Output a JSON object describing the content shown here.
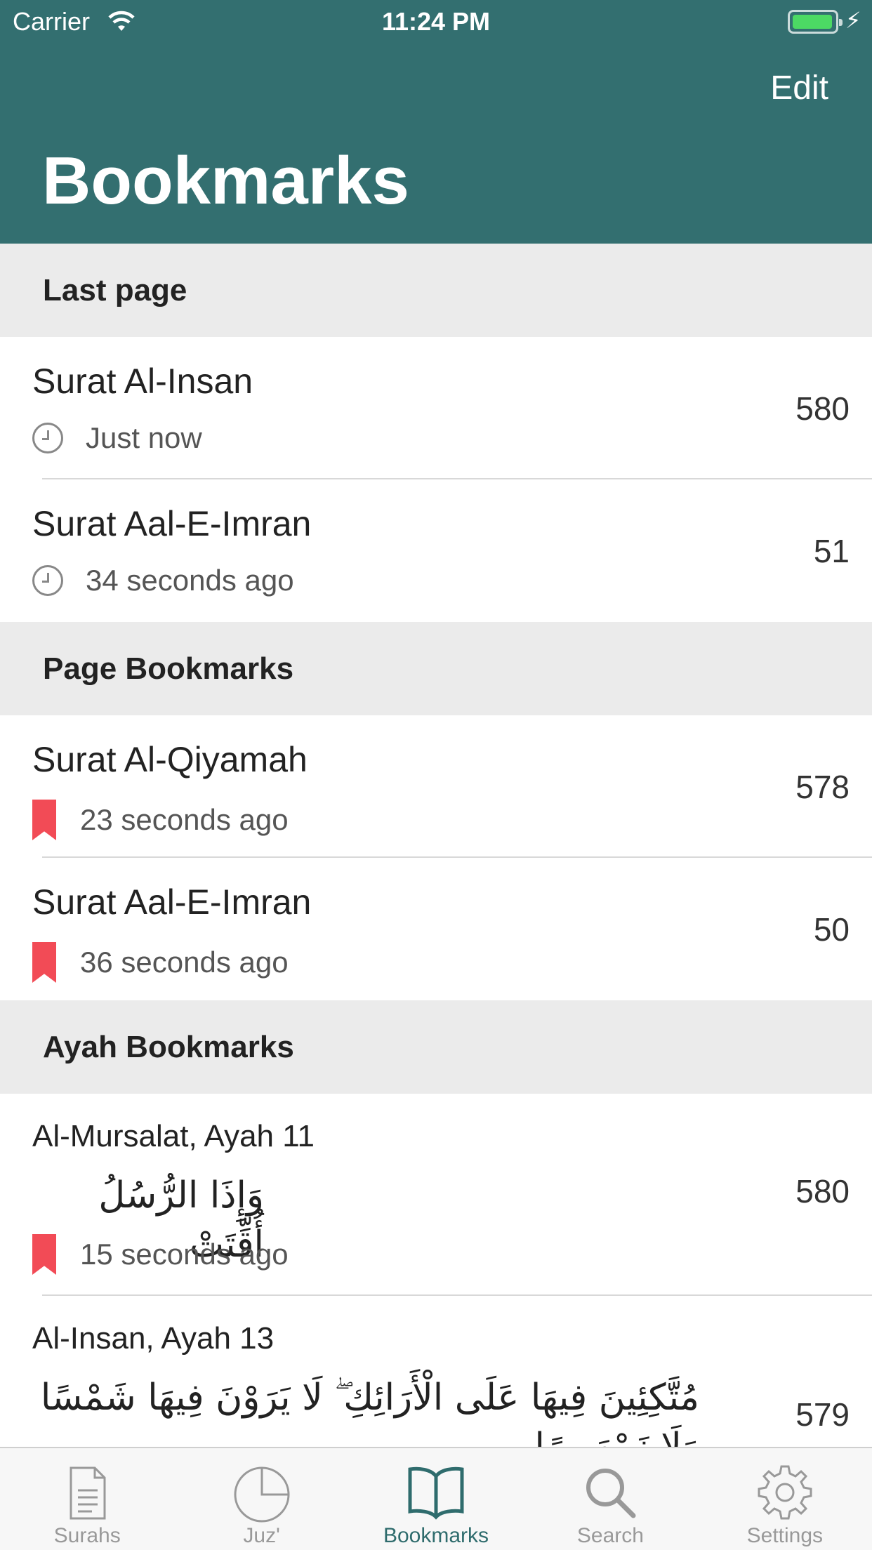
{
  "status_bar": {
    "carrier": "Carrier",
    "time": "11:24 PM"
  },
  "header": {
    "edit_label": "Edit",
    "title": "Bookmarks"
  },
  "sections": {
    "last_page": {
      "title": "Last page",
      "items": [
        {
          "title": "Surat Al-Insan",
          "time": "Just now",
          "page": "580",
          "icon": "clock-icon"
        },
        {
          "title": "Surat Aal-E-Imran",
          "time": "34 seconds ago",
          "page": "51",
          "icon": "clock-icon"
        }
      ]
    },
    "page_bookmarks": {
      "title": "Page Bookmarks",
      "items": [
        {
          "title": "Surat Al-Qiyamah",
          "time": "23 seconds ago",
          "page": "578",
          "icon": "bookmark-icon"
        },
        {
          "title": "Surat Aal-E-Imran",
          "time": "36 seconds ago",
          "page": "50",
          "icon": "bookmark-icon"
        }
      ]
    },
    "ayah_bookmarks": {
      "title": "Ayah Bookmarks",
      "items": [
        {
          "title": "Al-Mursalat, Ayah 11",
          "text": "وَإِذَا الرُّسُلُ أُقِّتَتْ",
          "time": "15 seconds ago",
          "page": "580",
          "icon": "bookmark-icon"
        },
        {
          "title": "Al-Insan, Ayah 13",
          "text": "مُتَّكِئِينَ فِيهَا عَلَى الْأَرَائِكِ ۖ لَا يَرَوْنَ فِيهَا شَمْسًا وَلَا زَمْهَرِيرًا",
          "page": "579"
        }
      ]
    }
  },
  "tab_bar": {
    "items": [
      {
        "label": "Surahs",
        "icon": "document-icon"
      },
      {
        "label": "Juz'",
        "icon": "pie-icon"
      },
      {
        "label": "Bookmarks",
        "icon": "book-icon",
        "active": true
      },
      {
        "label": "Search",
        "icon": "search-icon"
      },
      {
        "label": "Settings",
        "icon": "gear-icon"
      }
    ]
  },
  "colors": {
    "accent": "#336f70",
    "bookmark": "#f24b56",
    "section_bg": "#ebebeb"
  }
}
